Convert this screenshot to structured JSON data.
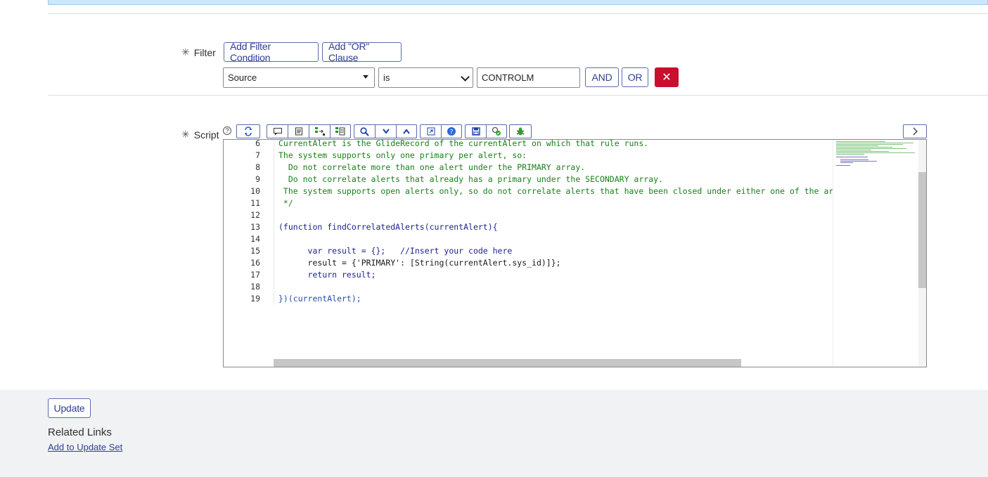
{
  "filter": {
    "label": "Filter",
    "add_condition": "Add Filter Condition",
    "add_or": "Add \"OR\" Clause",
    "field_value": "Source",
    "operator_value": "is",
    "input_value": "CONTROLM",
    "and_label": "AND",
    "or_label": "OR",
    "delete_glyph": "✕"
  },
  "script": {
    "label": "Script",
    "help_glyph": "?",
    "lines": [
      {
        "n": "6",
        "text": "CurrentAlert is the GlideRecord of the currentAlert on which that rule runs."
      },
      {
        "n": "7",
        "text": "The system supports only one primary per alert, so:"
      },
      {
        "n": "8",
        "text": "  Do not correlate more than one alert under the PRIMARY array."
      },
      {
        "n": "9",
        "text": "  Do not correlate alerts that already has a primary under the SECONDARY array."
      },
      {
        "n": "10",
        "text": " The system supports open alerts only, so do not correlate alerts that have been closed under either one of the ar"
      },
      {
        "n": "11",
        "text": " */"
      },
      {
        "n": "12",
        "text": ""
      },
      {
        "n": "13",
        "text": "(function findCorrelatedAlerts(currentAlert){"
      },
      {
        "n": "14",
        "text": ""
      },
      {
        "n": "15",
        "text": "      var result = {};   //Insert your code here"
      },
      {
        "n": "16",
        "text": "      result = {'PRIMARY': [String(currentAlert.sys_id)]};"
      },
      {
        "n": "17",
        "text": "      return result;"
      },
      {
        "n": "18",
        "text": ""
      },
      {
        "n": "19",
        "text": "})(currentAlert);"
      }
    ]
  },
  "footer": {
    "update": "Update",
    "related_links": "Related Links",
    "add_to_update_set": "Add to Update Set"
  },
  "colors": {
    "accent": "#2f3f8f",
    "danger": "#c8102e",
    "comment": "#1a7f1a"
  }
}
